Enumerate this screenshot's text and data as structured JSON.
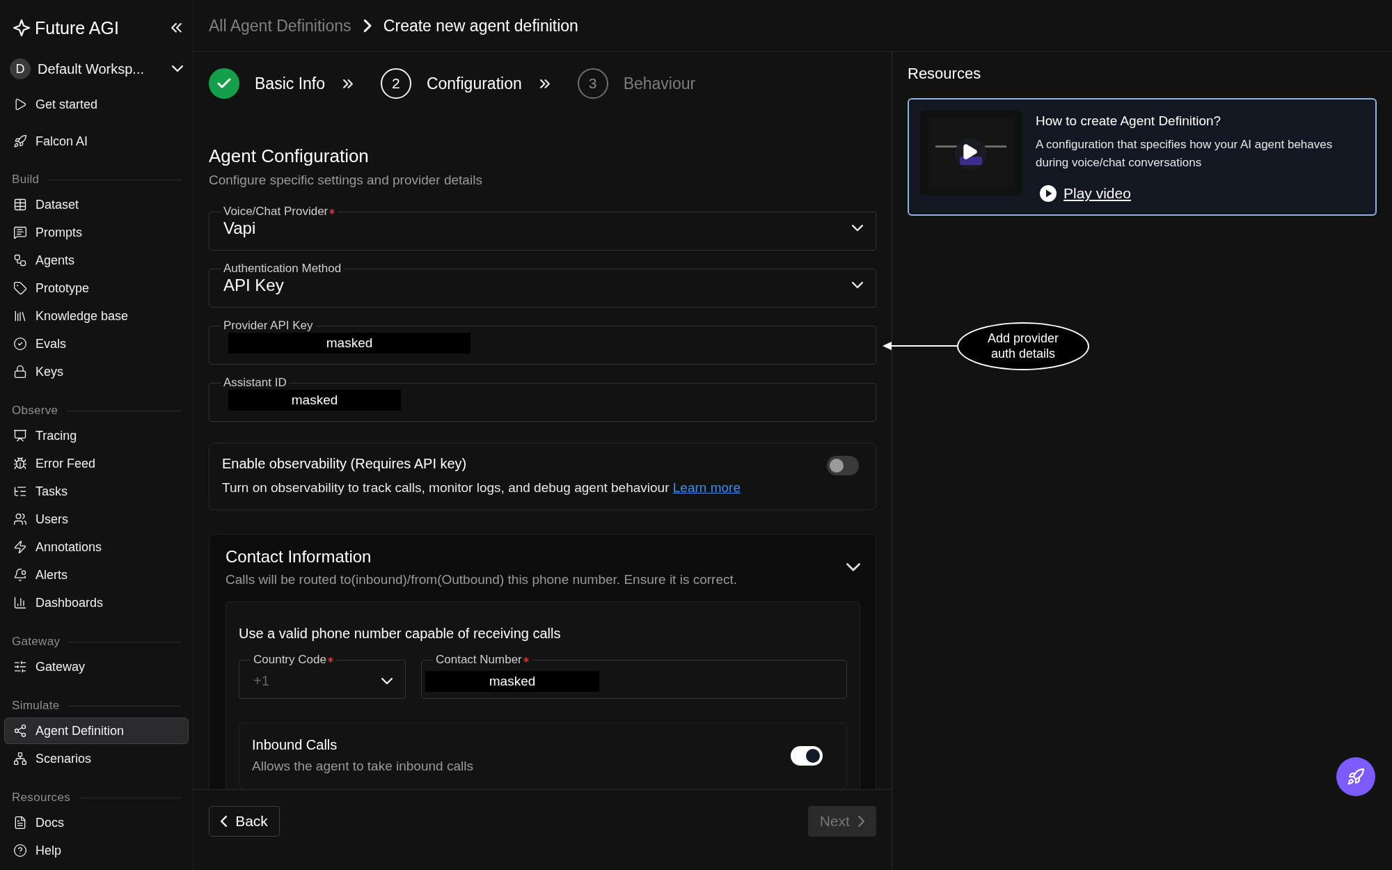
{
  "brand": {
    "name": "Future AGI"
  },
  "workspace": {
    "initial": "D",
    "name": "Default Worksp..."
  },
  "sidebar": {
    "top_items": [
      {
        "label": "Get started",
        "selected": false
      },
      {
        "label": "Falcon AI",
        "selected": false
      }
    ],
    "sections": [
      {
        "title": "Build",
        "items": [
          {
            "label": "Dataset",
            "selected": false
          },
          {
            "label": "Prompts",
            "selected": false
          },
          {
            "label": "Agents",
            "selected": false
          },
          {
            "label": "Prototype",
            "selected": false
          },
          {
            "label": "Knowledge base",
            "selected": false
          },
          {
            "label": "Evals",
            "selected": false
          },
          {
            "label": "Keys",
            "selected": false
          }
        ]
      },
      {
        "title": "Observe",
        "items": [
          {
            "label": "Tracing",
            "selected": false
          },
          {
            "label": "Error Feed",
            "selected": false
          },
          {
            "label": "Tasks",
            "selected": false
          },
          {
            "label": "Users",
            "selected": false
          },
          {
            "label": "Annotations",
            "selected": false
          },
          {
            "label": "Alerts",
            "selected": false
          },
          {
            "label": "Dashboards",
            "selected": false
          }
        ]
      },
      {
        "title": "Gateway",
        "items": [
          {
            "label": "Gateway",
            "selected": false
          }
        ]
      },
      {
        "title": "Simulate",
        "items": [
          {
            "label": "Agent Definition",
            "selected": true
          },
          {
            "label": "Scenarios",
            "selected": false
          }
        ]
      },
      {
        "title": "Resources",
        "items": [
          {
            "label": "Docs",
            "selected": false
          },
          {
            "label": "Help",
            "selected": false
          }
        ]
      }
    ]
  },
  "breadcrumb": {
    "parent": "All Agent Definitions",
    "current": "Create new agent definition"
  },
  "steps": [
    {
      "label": "Basic Info",
      "completed": true,
      "selected": false
    },
    {
      "number": "2",
      "label": "Configuration",
      "completed": false,
      "selected": true
    },
    {
      "number": "3",
      "label": "Behaviour",
      "completed": false,
      "selected": false
    }
  ],
  "section": {
    "title": "Agent Configuration",
    "subtitle": "Configure specific settings and provider details"
  },
  "fields": [
    {
      "kind": "select",
      "label": "Voice/Chat Provider",
      "required": true,
      "value": "Vapi"
    },
    {
      "kind": "select",
      "label": "Authentication Method",
      "required": false,
      "value": "API Key"
    },
    {
      "kind": "masked",
      "label": "Provider API Key",
      "required": false,
      "value": "masked"
    },
    {
      "kind": "masked",
      "label": "Assistant ID",
      "required": false,
      "value": "masked"
    }
  ],
  "observability": {
    "title": "Enable observability (Requires API key)",
    "description": "Turn on observability to track calls, monitor logs, and debug agent behaviour",
    "link": "Learn more",
    "on": false
  },
  "contact": {
    "title": "Contact Information",
    "subtitle": "Calls will be routed to(inbound)/from(Outbound) this phone number. Ensure it is correct.",
    "expanded": true,
    "hint": "Use a valid phone number capable of receiving calls",
    "country_code": {
      "label": "Country Code",
      "required": true,
      "placeholder": "+1"
    },
    "contact_number": {
      "label": "Contact Number",
      "required": true,
      "value": "masked"
    },
    "inbound": {
      "title": "Inbound Calls",
      "description": "Allows the agent to take inbound calls",
      "on": true
    }
  },
  "footer": {
    "back": "Back",
    "next": "Next",
    "next_disabled": true
  },
  "resources": {
    "title": "Resources",
    "card": {
      "title": "How to create Agent Definition?",
      "description": "A configuration that specifies how your AI agent behaves during voice/chat conversations",
      "link": "Play video"
    }
  },
  "annotation": {
    "text": "Add provider auth details"
  }
}
